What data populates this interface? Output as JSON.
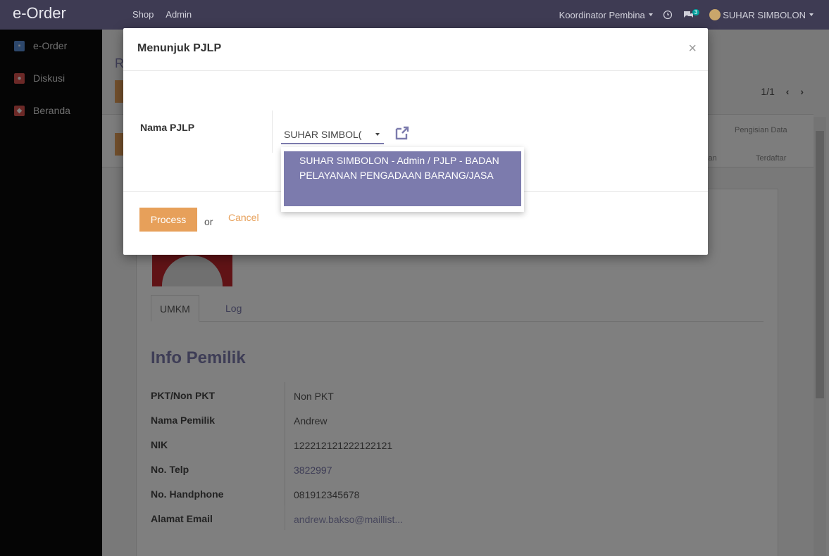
{
  "app": {
    "brand": "e-Order",
    "top_menu": [
      "Shop",
      "Admin"
    ],
    "role_menu": "Koordinator Pembina",
    "message_count": "3",
    "user_name": "SUHAR SIMBOLON"
  },
  "sidebar": {
    "items": [
      {
        "label": "e-Order",
        "icon": "cart-icon",
        "color": "#5a8fd6"
      },
      {
        "label": "Diskusi",
        "icon": "chat-icon",
        "color": "#d9534f"
      },
      {
        "label": "Beranda",
        "icon": "home-icon",
        "color": "#d9534f"
      }
    ]
  },
  "background": {
    "title_partial": "R",
    "pager_text": "1/1",
    "status_tabs": [
      "Pengisian Data",
      "juan",
      "Terdaftar"
    ],
    "tabs": [
      "UMKM",
      "Log"
    ],
    "section_title": "Info Pemilik",
    "info_rows": [
      {
        "label": "PKT/Non PKT",
        "value": "Non PKT"
      },
      {
        "label": "Nama Pemilik",
        "value": "Andrew"
      },
      {
        "label": "NIK",
        "value": "122212121222122121"
      },
      {
        "label": "No. Telp",
        "value": "3822997"
      },
      {
        "label": "No. Handphone",
        "value": "081912345678"
      },
      {
        "label": "Alamat Email",
        "value": "andrew.bakso@maillist..."
      }
    ]
  },
  "modal": {
    "title": "Menunjuk PJLP",
    "close_symbol": "×",
    "field_label": "Nama PJLP",
    "select_value": "SUHAR SIMBOL(",
    "dropdown_option": "SUHAR SIMBOLON - Admin / PJLP - BADAN PELAYANAN PENGADAAN BARANG/JASA",
    "process_label": "Process",
    "or_text": "or",
    "cancel_label": "Cancel"
  },
  "colors": {
    "navbar": "#3e3b53",
    "accent_purple": "#7c7bad",
    "accent_orange": "#e7a05a"
  }
}
